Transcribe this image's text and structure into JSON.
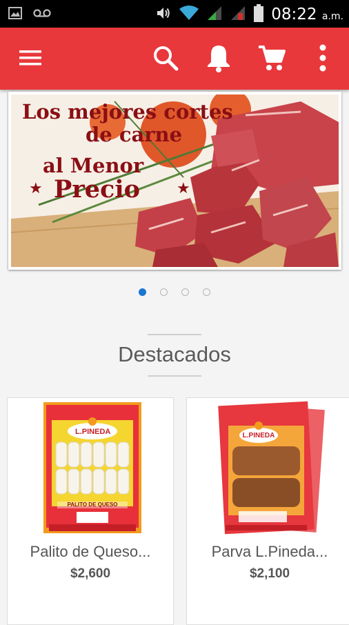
{
  "status_bar": {
    "time": "08:22",
    "ampm": "a.m."
  },
  "toolbar": {
    "icons": [
      "menu-icon",
      "search-icon",
      "notifications-icon",
      "cart-icon",
      "more-vert-icon"
    ],
    "color": "#e8383c"
  },
  "banner": {
    "line1": "Los mejores cortes",
    "line2": "de carne",
    "line3": "al Menor",
    "line4": "Precio",
    "slides": 4,
    "active_slide": 1
  },
  "section": {
    "title": "Destacados"
  },
  "products": [
    {
      "name": "Palito de Queso...",
      "price": "$2,600",
      "brand": "L.PINEDA",
      "label": "PALITO DE QUESO"
    },
    {
      "name": "Parva L.Pineda...",
      "price": "$2,100",
      "brand": "L.PINEDA",
      "label": ""
    }
  ],
  "colors": {
    "accent": "#e8383c",
    "dot_active": "#1976d2"
  }
}
